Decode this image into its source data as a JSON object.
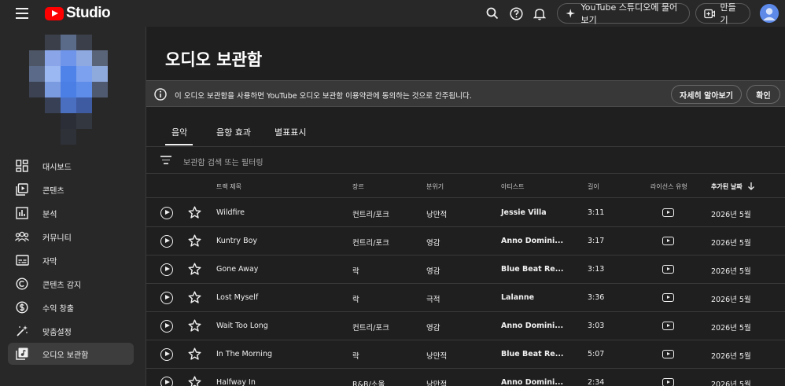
{
  "app": {
    "title": "Studio"
  },
  "topbar": {
    "sparkle_button": "YouTube 스튜디오에 물어보기",
    "create_button": "만들기"
  },
  "sidebar": {
    "items": [
      {
        "label": "대시보드",
        "icon": "dashboard-icon"
      },
      {
        "label": "콘텐츠",
        "icon": "content-icon"
      },
      {
        "label": "분석",
        "icon": "analytics-icon"
      },
      {
        "label": "커뮤니티",
        "icon": "community-icon"
      },
      {
        "label": "자막",
        "icon": "subtitles-icon"
      },
      {
        "label": "콘텐츠 감지",
        "icon": "copyright-icon"
      },
      {
        "label": "수익 창출",
        "icon": "monetization-icon"
      },
      {
        "label": "맞춤설정",
        "icon": "customization-icon"
      },
      {
        "label": "오디오 보관함",
        "icon": "audio-library-icon",
        "active": true
      }
    ]
  },
  "main": {
    "title": "오디오 보관함",
    "banner": {
      "text": "이 오디오 보관함을 사용하면 YouTube 오디오 보관함 이용약관에 동의하는 것으로 간주됩니다.",
      "learn_more": "자세히 알아보기",
      "confirm": "확인"
    },
    "tabs": [
      {
        "label": "음악",
        "selected": true
      },
      {
        "label": "음향 효과",
        "selected": false
      },
      {
        "label": "별표표시",
        "selected": false
      }
    ],
    "filter_placeholder": "보관함 검색 또는 필터링",
    "columns": {
      "track": "트랙 제목",
      "genre": "장르",
      "mood": "분위기",
      "artist": "아티스트",
      "duration": "길이",
      "license": "라이선스 유형",
      "added": "추가된 날짜"
    },
    "rows": [
      {
        "title": "Wildfire",
        "genre": "컨트리/포크",
        "mood": "낭만적",
        "artist": "Jessie Villa",
        "duration": "3:11",
        "added": "2026년 5월"
      },
      {
        "title": "Kuntry Boy",
        "genre": "컨트리/포크",
        "mood": "영감",
        "artist": "Anno Domini...",
        "duration": "3:17",
        "added": "2026년 5월"
      },
      {
        "title": "Gone Away",
        "genre": "락",
        "mood": "영감",
        "artist": "Blue Beat Re...",
        "duration": "3:13",
        "added": "2026년 5월"
      },
      {
        "title": "Lost Myself",
        "genre": "락",
        "mood": "극적",
        "artist": "Lalanne",
        "duration": "3:36",
        "added": "2026년 5월"
      },
      {
        "title": "Wait Too Long",
        "genre": "컨트리/포크",
        "mood": "영감",
        "artist": "Anno Domini...",
        "duration": "3:03",
        "added": "2026년 5월"
      },
      {
        "title": "In The Morning",
        "genre": "락",
        "mood": "낭만적",
        "artist": "Blue Beat Re...",
        "duration": "5:07",
        "added": "2026년 5월"
      },
      {
        "title": "Halfway In",
        "genre": "R&B/소울",
        "mood": "낭만적",
        "artist": "Anno Domini...",
        "duration": "2:34",
        "added": "2026년 5월"
      }
    ]
  },
  "colors": {
    "brand_red": "#ff0000",
    "background": "#1f1f1f",
    "sidebar": "#282828",
    "banner": "#383838"
  }
}
